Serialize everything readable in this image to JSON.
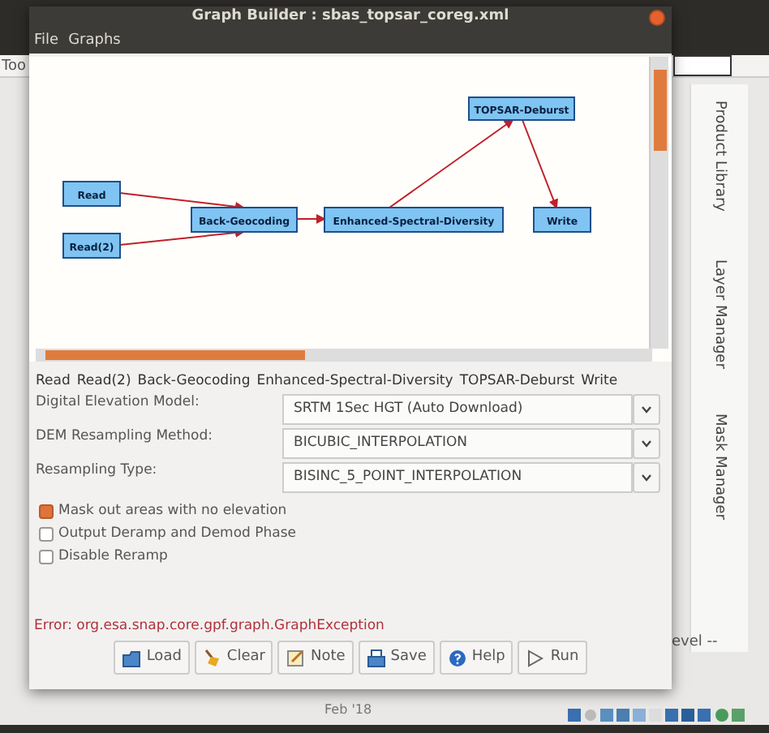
{
  "background": {
    "toolbar_label": "Too",
    "panel_label": "evel --",
    "date": "Feb '18",
    "side_tabs": [
      {
        "label": "Product Library"
      },
      {
        "label": "Layer Manager"
      },
      {
        "label": "Mask Manager"
      }
    ]
  },
  "window": {
    "title": "Graph Builder : sbas_topsar_coreg.xml"
  },
  "menu": [
    "File",
    "Graphs"
  ],
  "graph": {
    "nodes": [
      {
        "label": "Read"
      },
      {
        "label": "Read(2)"
      },
      {
        "label": "Back-Geocoding"
      },
      {
        "label": "Enhanced-Spectral-Diversity"
      },
      {
        "label": "TOPSAR-Deburst"
      },
      {
        "label": "Write"
      }
    ]
  },
  "tabs": [
    "Read",
    "Read(2)",
    "Back-Geocoding",
    "Enhanced-Spectral-Diversity",
    "TOPSAR-Deburst",
    "Write"
  ],
  "fields": [
    {
      "label": "Digital Elevation Model:",
      "value": "SRTM 1Sec HGT (Auto Download)"
    },
    {
      "label": "DEM Resampling Method:",
      "value": "BICUBIC_INTERPOLATION"
    },
    {
      "label": "Resampling Type:",
      "value": "BISINC_5_POINT_INTERPOLATION"
    }
  ],
  "options": [
    {
      "label": "Mask out areas with no elevation",
      "checked": true
    },
    {
      "label": "Output Deramp and Demod Phase",
      "checked": false
    },
    {
      "label": "Disable Reramp",
      "checked": false
    }
  ],
  "error": "Error: org.esa.snap.core.gpf.graph.GraphException",
  "buttons": [
    {
      "kind": "load",
      "label": "Load"
    },
    {
      "kind": "clear",
      "label": "Clear"
    },
    {
      "kind": "note",
      "label": "Note"
    },
    {
      "kind": "save",
      "label": "Save"
    },
    {
      "kind": "help",
      "label": "Help"
    },
    {
      "kind": "run",
      "label": "Run"
    }
  ]
}
